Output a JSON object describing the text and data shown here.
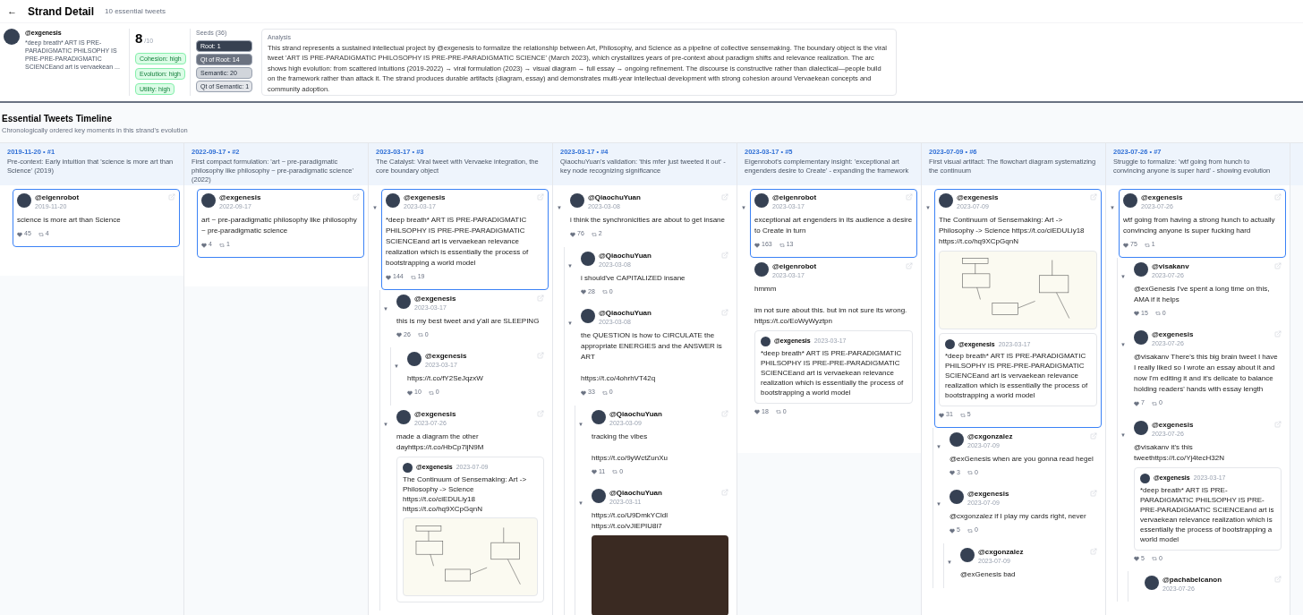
{
  "header": {
    "back": "←",
    "title": "Strand Detail",
    "subtitle": "10 essential tweets"
  },
  "summary": {
    "handle": "@exgenesis",
    "snippet": "*deep breath* ART IS PRE-PARADIGMATIC PHILSOPHY IS PRE-PRE-PARADIGMATIC SCIENCEand art is vervaekean ...",
    "score": "8",
    "score_max": "/10",
    "badges": [
      "Cohesion: high",
      "Evolution: high",
      "Utility: high"
    ],
    "seeds_title": "Seeds (36)",
    "seeds": [
      {
        "label": "Root: 1",
        "color": "#374151"
      },
      {
        "label": "Qt of Root: 14",
        "color": "#6b7280"
      },
      {
        "label": "Semantic: 20",
        "color": "#d1d5db"
      },
      {
        "label": "Qt of Semantic: 1",
        "color": "#e5e7eb"
      }
    ],
    "analysis_title": "Analysis",
    "analysis": "This strand represents a sustained intellectual project by @exgenesis to formalize the relationship between Art, Philosophy, and Science as a pipeline of collective sensemaking. The boundary object is the viral tweet 'ART IS PRE-PARADIGMATIC PHILOSOPHY IS PRE-PRE-PARADIGMATIC SCIENCE' (March 2023), which crystallizes years of pre-context about paradigm shifts and relevance realization. The arc shows high evolution: from scattered intuitions (2019-2022) → viral formulation (2023) → visual diagram → full essay → ongoing refinement. The discourse is constructive rather than dialectical—people build on the framework rather than attack it. The strand produces durable artifacts (diagram, essay) and demonstrates multi-year intellectual development with strong cohesion around Vervaekean concepts and community adoption."
  },
  "timeline": {
    "title": "Essential Tweets Timeline",
    "subtitle": "Chronologically ordered key moments in this strand's evolution",
    "columns": [
      {
        "label": "2019-11-20 • #1",
        "description": "Pre-context: Early intuition that 'science is more art than Science' (2019)",
        "tweets": [
          {
            "handle": "@eigenrobot",
            "date": "2019-11-20",
            "text": "science is more art than Science",
            "likes": "45",
            "retweets": "4",
            "selected": true
          }
        ]
      },
      {
        "label": "2022-09-17 • #2",
        "description": "First compact formulation: 'art ~ pre-paradigmatic philosophy like philosophy ~ pre-paradigmatic science' (2022)",
        "tweets": [
          {
            "handle": "@exgenesis",
            "date": "2022-09-17",
            "text": "art ~ pre-paradigmatic philosophy like philosophy ~ pre-paradigmatic science",
            "likes": "4",
            "retweets": "1",
            "selected": true
          }
        ]
      },
      {
        "label": "2023-03-17 • #3",
        "description": "The Catalyst: Viral tweet with Vervaeke integration, the core boundary object",
        "tweets": [
          {
            "toggle": "▼",
            "handle": "@exgenesis",
            "date": "2023-03-17",
            "text": "*deep breath* ART IS PRE-PARADIGMATIC PHILSOPHY IS PRE-PRE-PARADIGMATIC SCIENCEand art is vervaekean relevance realization which is essentially the process of bootstrapping a world model",
            "likes": "144",
            "retweets": "19",
            "selected": true,
            "children": [
              {
                "toggle": "▼",
                "handle": "@exgenesis",
                "date": "2023-03-17",
                "text": "this is my best tweet and y'all are SLEEPING",
                "likes": "26",
                "retweets": "0",
                "selected": false,
                "children": [
                  {
                    "toggle": "▼",
                    "handle": "@exgenesis",
                    "date": "2023-03-17",
                    "text": "https://t.co/fY2SeJqzxW",
                    "likes": "10",
                    "retweets": "0",
                    "selected": false
                  }
                ]
              },
              {
                "toggle": "▼",
                "handle": "@exgenesis",
                "date": "2023-07-26",
                "text": "made a diagram the other dayhttps://t.co/HbCp7ljN9M",
                "selected": false,
                "quote": {
                  "handle": "@exgenesis",
                  "date": "2023-07-09",
                  "text": "The Continuum of Sensemaking: Art -> Philosophy -> Science https://t.co/ciEDULiy18 https://t.co/hq9XCpGqnN",
                  "media": {
                    "kind": "diagram"
                  }
                }
              }
            ]
          }
        ]
      },
      {
        "label": "2023-03-17 • #4",
        "description": "QiaochuYuan's validation: 'this mfer just tweeted it out' - key node recognizing significance",
        "tweets": [
          {
            "toggle": "▼",
            "handle": "@QiaochuYuan",
            "date": "2023-03-08",
            "text": "i think the synchronicities are about to get insane",
            "likes": "76",
            "retweets": "2",
            "selected": false,
            "children": [
              {
                "toggle": "▼",
                "handle": "@QiaochuYuan",
                "date": "2023-03-08",
                "text": "i should've CAPITALIZED insane",
                "likes": "28",
                "retweets": "0",
                "selected": false
              },
              {
                "toggle": "▼",
                "handle": "@QiaochuYuan",
                "date": "2023-03-08",
                "text": "the QUESTION is how to CIRCULATE the appropriate ENERGIES and the ANSWER is ART\n\nhttps://t.co/4ohrhVT42q",
                "likes": "33",
                "retweets": "0",
                "selected": false,
                "children": [
                  {
                    "toggle": "▼",
                    "handle": "@QiaochuYuan",
                    "date": "2023-03-09",
                    "text": "tracking the vibes\n\nhttps://t.co/9yWctZunXu",
                    "likes": "11",
                    "retweets": "0",
                    "selected": false
                  },
                  {
                    "toggle": "▼",
                    "handle": "@QiaochuYuan",
                    "date": "2023-03-11",
                    "text": "https://t.co/U9DmkYCldl https://t.co/vJIEPIU8i7",
                    "media": {
                      "kind": "photo"
                    },
                    "selected": false
                  }
                ]
              }
            ]
          }
        ]
      },
      {
        "label": "2023-03-17 • #5",
        "description": "Eigenrobot's complementary insight: 'exceptional art engenders desire to Create' - expanding the framework",
        "tweets": [
          {
            "toggle": "▼",
            "handle": "@eigenrobot",
            "date": "2023-03-17",
            "text": "exceptional art engenders in its audience a desire to Create in turn",
            "likes": "163",
            "retweets": "13",
            "selected": true
          },
          {
            "handle": "@eigenrobot",
            "date": "2023-03-17",
            "text": "hmmm\n\nim not sure about this. but im not sure its wrong. https://t.co/EoWyWyztpn",
            "likes": "18",
            "retweets": "0",
            "selected": false,
            "quote": {
              "handle": "@exgenesis",
              "date": "2023-03-17",
              "text": "*deep breath* ART IS PRE-PARADIGMATIC PHILSOPHY IS PRE-PRE-PARADIGMATIC SCIENCEand art is vervaekean relevance realization which is essentially the process of bootstrapping a world model"
            }
          }
        ]
      },
      {
        "label": "2023-07-09 • #6",
        "description": "First visual artifact: The flowchart diagram systematizing the continuum",
        "tweets": [
          {
            "toggle": "▼",
            "handle": "@exgenesis",
            "date": "2023-07-09",
            "text": "The Continuum of Sensemaking: Art -> Philosophy -> Science https://t.co/ciEDULiy18 https://t.co/hq9XCpGqnN",
            "media": {
              "kind": "diagram"
            },
            "likes": "31",
            "retweets": "5",
            "selected": true,
            "quote": {
              "handle": "@exgenesis",
              "date": "2023-03-17",
              "text": "*deep breath* ART IS PRE-PARADIGMATIC PHILSOPHY IS PRE-PRE-PARADIGMATIC SCIENCEand art is vervaekean relevance realization which is essentially the process of bootstrapping a world model"
            },
            "children": [
              {
                "toggle": "▼",
                "handle": "@cxgonzalez",
                "date": "2023-07-09",
                "text": "@exGenesis when are you gonna read hegel",
                "likes": "3",
                "retweets": "0",
                "selected": false
              },
              {
                "toggle": "▼",
                "handle": "@exgenesis",
                "date": "2023-07-09",
                "text": "@cxgonzalez if I play my cards right, never",
                "likes": "5",
                "retweets": "0",
                "selected": false,
                "children": [
                  {
                    "toggle": "▼",
                    "handle": "@cxgonzalez",
                    "date": "2023-07-09",
                    "text": "@exGenesis bad",
                    "selected": false
                  }
                ]
              }
            ]
          }
        ]
      },
      {
        "label": "2023-07-26 • #7",
        "description": "Struggle to formalize: 'wtf going from hunch to convincing anyone is super hard' - showing evolution",
        "tweets": [
          {
            "toggle": "▼",
            "handle": "@exgenesis",
            "date": "2023-07-26",
            "text": "wtf going from having a strong hunch to actually convincing anyone is super fucking hard",
            "likes": "75",
            "retweets": "1",
            "selected": true,
            "children": [
              {
                "toggle": "▼",
                "handle": "@visakanv",
                "date": "2023-07-26",
                "text": "@exGenesis I've spent a long time on this, AMA if it helps",
                "likes": "15",
                "retweets": "0",
                "selected": false
              },
              {
                "toggle": "▼",
                "handle": "@exgenesis",
                "date": "2023-07-26",
                "text": "@visakanv There's this big brain tweet I have I really liked so I wrote an essay about it and now I'm editing it and it's delicate to balance holding readers' hands with essay length",
                "likes": "7",
                "retweets": "0",
                "selected": false
              },
              {
                "toggle": "▼",
                "handle": "@exgenesis",
                "date": "2023-07-26",
                "text": "@visakanv it's this tweethttps://t.co/Yj4tecH32N",
                "likes": "5",
                "retweets": "0",
                "selected": false,
                "quote": {
                  "handle": "@exgenesis",
                  "date": "2023-03-17",
                  "text": "*deep breath* ART IS PRE-PARADIGMATIC PHILSOPHY IS PRE-PRE-PARADIGMATIC SCIENCEand art is vervaekean relevance realization which is essentially the process of bootstrapping a world model"
                },
                "children": [
                  {
                    "handle": "@pachabelcanon",
                    "date": "2023-07-26",
                    "selected": false
                  }
                ]
              }
            ]
          }
        ]
      }
    ]
  }
}
